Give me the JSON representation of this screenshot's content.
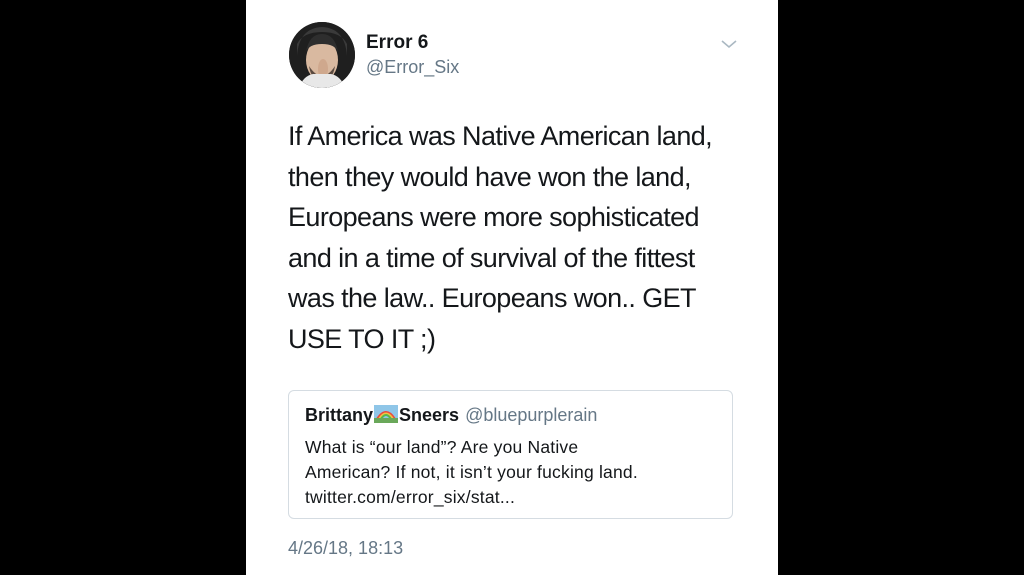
{
  "tweet": {
    "author": {
      "display_name": "Error 6",
      "handle": "@Error_Six"
    },
    "text_lines": [
      "If America was Native American land,",
      "then they would have won the land,",
      "Europeans were more sophisticated",
      "and in a time of survival of the fittest",
      "was the law.. Europeans won.. GET",
      "USE TO IT  ;)"
    ],
    "timestamp": "4/26/18, 18:13"
  },
  "quoted_tweet": {
    "name_part1": "Brittany",
    "name_emoji": "rainbow-emoji",
    "name_part2": "Sneers",
    "handle": "@bluepurplerain",
    "text_lines": [
      "What is “our land”? Are you Native",
      "American? If not, it isn’t your fucking land.",
      "twitter.com/error_six/stat..."
    ]
  },
  "colors": {
    "background": "#000000",
    "card": "#ffffff",
    "primary_text": "#14171a",
    "secondary_text": "#657786",
    "border": "#d5dce2"
  },
  "icons": {
    "menu": "chevron-down-icon"
  }
}
